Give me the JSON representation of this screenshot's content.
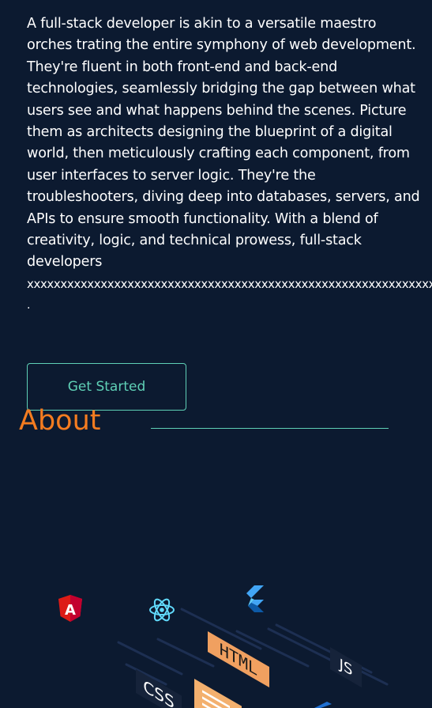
{
  "hero": {
    "description": "A full-stack developer is akin to a versatile maestro orches trating the entire symphony of web development. They're fluent in both front-end and back-end technologies, seamlessly bridging the gap between what users see and what happens behind the scenes. Picture them as architects designing the blueprint of a digital world, then meticulously crafting each component, from user interfaces to server logic. They're the troubleshooters, diving deep into databases, servers, and APIs to ensure smooth functionality. With a blend of creativity, logic, and technical prowess, full-stack developers",
    "overflow_text": "xxxxxxxxxxxxxxxxxxxxxxxxxxxxxxxxxxxxxxxxxxxxxxxxxxxxxxxxxxxxxxxxx",
    "trailing": ".",
    "cta_label": "Get Started"
  },
  "about": {
    "heading": "About"
  },
  "illustration": {
    "html_label": "HTML",
    "css_label": "CSS",
    "js_label": "JS",
    "angular_letter": "A",
    "icons": [
      "angular-icon",
      "react-icon",
      "flutter-icon",
      "html-icon",
      "css-icon",
      "js-icon"
    ],
    "colors": {
      "angular": "#dd1b16",
      "react": "#61dafb",
      "flutter": "#42a5f5",
      "html_tag": "#f0a060",
      "css_tag": "#1e2b3e",
      "js_tag": "#1e2b3e",
      "accent": "#5fd0b6",
      "heading": "#f47c20"
    }
  }
}
